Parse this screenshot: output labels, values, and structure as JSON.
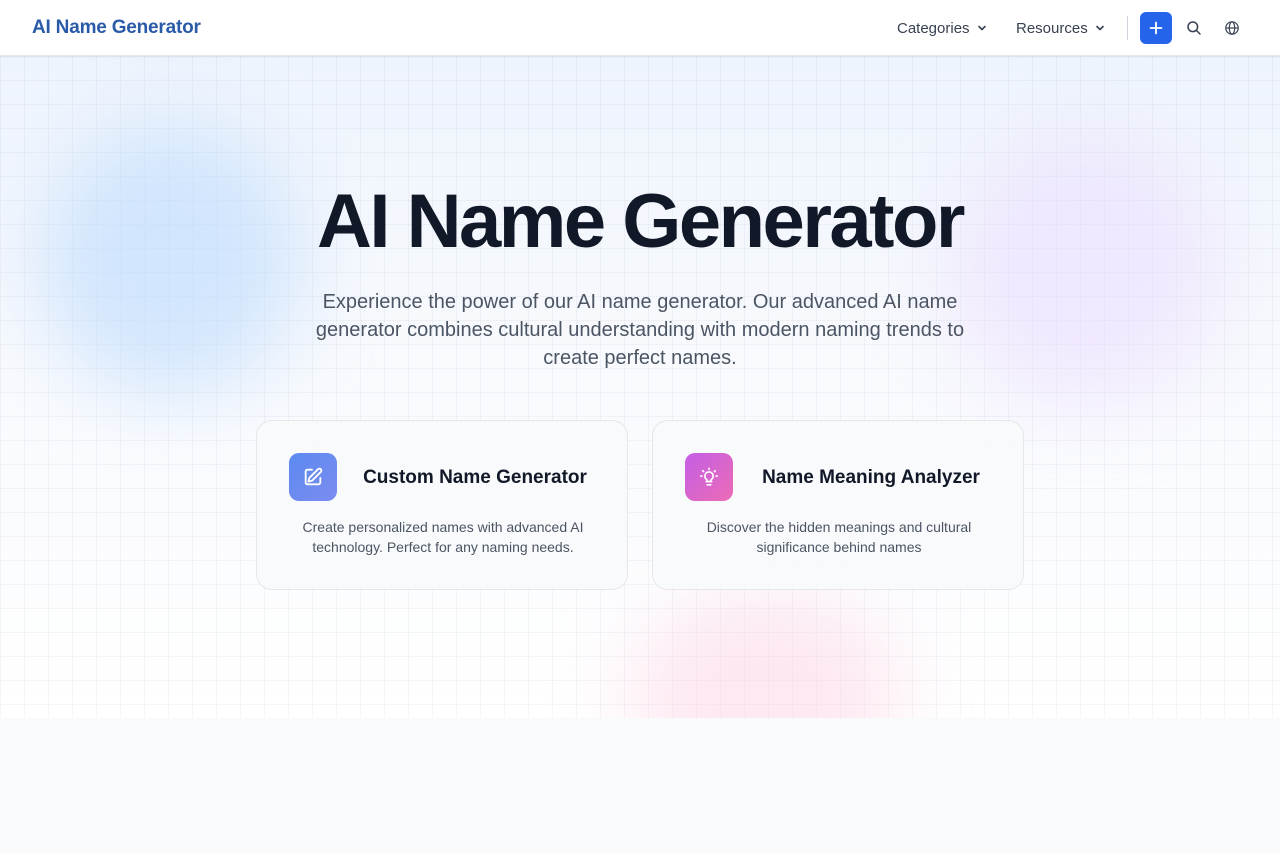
{
  "navbar": {
    "brand": "AI Name Generator",
    "links": [
      {
        "label": "Categories"
      },
      {
        "label": "Resources"
      }
    ],
    "icons": {
      "chevron": "chevron-down-icon",
      "plus": "plus-icon",
      "search": "search-icon",
      "language": "globe-icon"
    }
  },
  "hero": {
    "title": "AI Name Generator",
    "subtitle": "Experience the power of our AI name generator. Our advanced AI name generator combines cultural understanding with modern naming trends to create perfect names."
  },
  "cards": [
    {
      "title": "Custom Name Generator",
      "description": "Create personalized names with advanced AI technology. Perfect for any naming needs.",
      "icon": "pencil-square-icon",
      "gradient": [
        "#5b8af0",
        "#7c8cf0"
      ]
    },
    {
      "title": "Name Meaning Analyzer",
      "description": "Discover the hidden meanings and cultural significance behind names",
      "icon": "lightbulb-icon",
      "gradient": [
        "#c45ee6",
        "#ec6cb5"
      ]
    }
  ],
  "colors": {
    "brand": "#2a5aa8",
    "accent": "#2563eb",
    "heading": "#111827",
    "body": "#4b5563"
  }
}
